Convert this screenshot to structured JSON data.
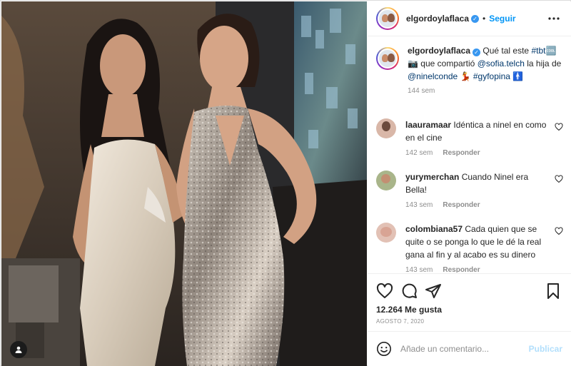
{
  "post": {
    "author": "elgordoylaflaca",
    "separator": "•",
    "follow_label": "Seguir",
    "caption": {
      "author": "elgordoylaflaca",
      "text_1": "Qué tal este",
      "hashtag_tbt": "#tbt",
      "tbt_emoji": "🆒📷",
      "text_2": "que compartió",
      "mention_1": "@sofia.telch",
      "text_3": "la hija de",
      "mention_2": "@ninelconde",
      "emoji_2": "💃",
      "hashtag_2": "#gyfopina",
      "emoji_3": "🚹",
      "time": "144 sem"
    },
    "comments": [
      {
        "user": "laauramaar",
        "text": "Idéntica a ninel en como en el cine",
        "time": "142 sem",
        "reply_label": "Responder"
      },
      {
        "user": "yurymerchan",
        "text": "Cuando Ninel era Bella!",
        "time": "143 sem",
        "reply_label": "Responder"
      },
      {
        "user": "colombiana57",
        "text": "Cada quien que se quite o se ponga lo que le dé la real gana al fin y al acabo es su dinero",
        "time": "143 sem",
        "reply_label": "Responder"
      }
    ],
    "likes": "12.264 Me gusta",
    "date": "AGOSTO 7, 2020",
    "comment_placeholder": "Añade un comentario...",
    "publish_label": "Publicar"
  },
  "icons": {
    "verified": "verified-badge-icon",
    "more": "more-options-icon",
    "like": "heart-icon",
    "comment": "comment-bubble-icon",
    "share": "paper-plane-icon",
    "save": "bookmark-icon",
    "emoji": "smiley-icon",
    "tag": "user-tag-icon"
  },
  "colors": {
    "accent": "#0095f6",
    "link": "#00376b",
    "muted": "#8e8e8e",
    "publish_disabled": "#b2dffc",
    "verified": "#3897f0"
  }
}
